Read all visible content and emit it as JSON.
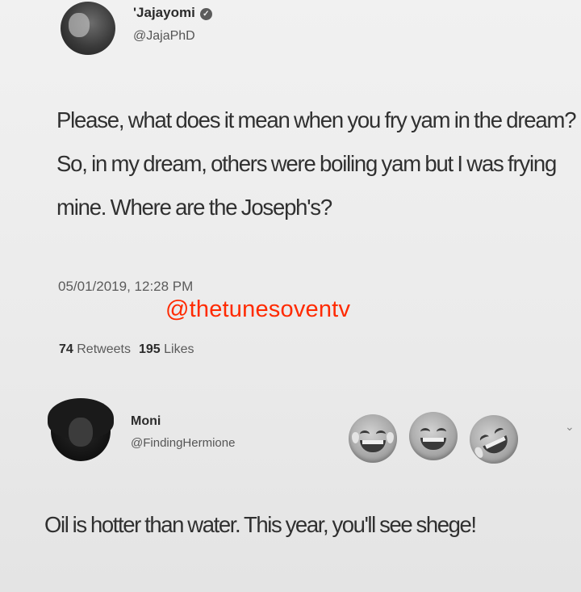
{
  "tweet": {
    "author_name": "'Jajayomi",
    "author_handle": "@JajaPhD",
    "verified_icon": "verified-badge-icon",
    "text": "Please, what does it mean when you fry yam in the dream? So, in my dream, others were boiling yam but I was frying mine. Where are the Joseph's?",
    "timestamp": "05/01/2019, 12:28 PM",
    "retweets_count": "74",
    "retweets_label": "Retweets",
    "likes_count": "195",
    "likes_label": "Likes"
  },
  "watermark": {
    "text": "@thetunesoventv",
    "color": "#ff2a00"
  },
  "reply": {
    "author_name": "Moni",
    "author_handle": "@FindingHermione",
    "emojis": [
      "face-with-tears-of-joy-icon",
      "grinning-face-icon",
      "rolling-on-floor-laughing-icon"
    ],
    "text": "Oil is hotter than water. This year, you'll see shege!"
  },
  "colors": {
    "background": "#ececec",
    "text": "#303030"
  }
}
